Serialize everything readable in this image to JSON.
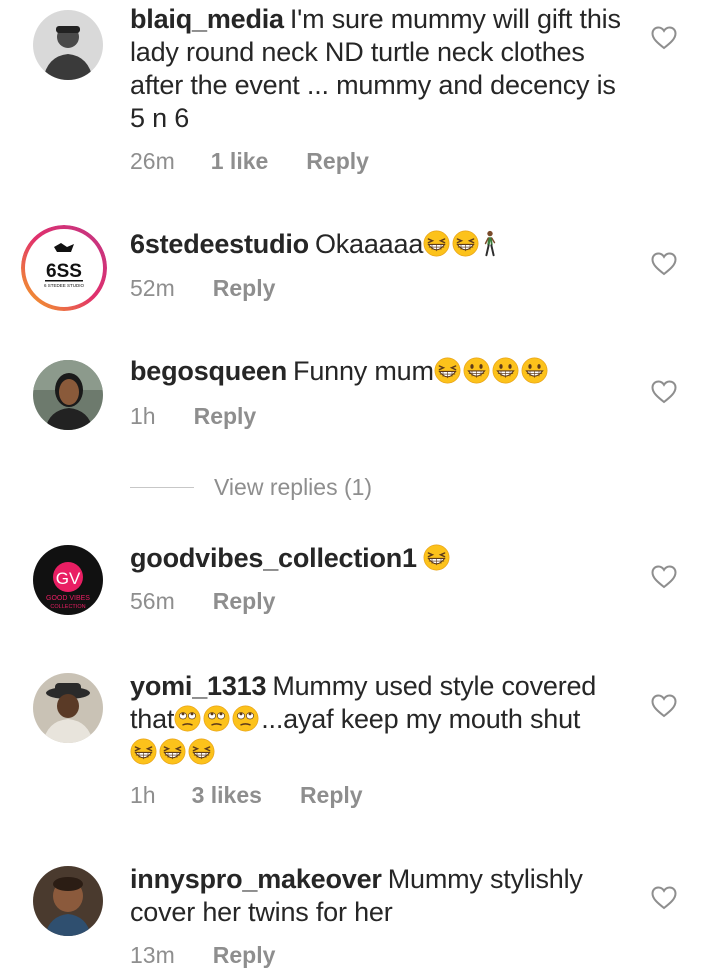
{
  "comments": [
    {
      "username": "blaiq_media",
      "text": "I'm sure mummy will gift this lady round neck ND turtle neck clothes after the event ... mummy and decency is 5 n 6",
      "time": "26m",
      "likes": "1 like",
      "reply": "Reply"
    },
    {
      "username": "6stedeestudio",
      "text": "Okaaaaa",
      "time": "52m",
      "reply": "Reply"
    },
    {
      "username": "begosqueen",
      "text": "Funny mum",
      "time": "1h",
      "reply": "Reply"
    },
    {
      "username": "goodvibes_collection1",
      "text": "",
      "time": "56m",
      "reply": "Reply"
    },
    {
      "username": "yomi_1313",
      "text_a": "Mummy used style covered that",
      "text_b": "...ayaf keep my mouth shut",
      "time": "1h",
      "likes": "3 likes",
      "reply": "Reply"
    },
    {
      "username": "innyspro_makeover",
      "text": "Mummy stylishly cover her twins for her",
      "time": "13m",
      "reply": "Reply"
    }
  ],
  "view_replies": "View replies (1)",
  "logos": {
    "studio_mark": "6SS",
    "studio_sub": "6 STEDEE STUDIO",
    "gv_mark": "GV",
    "gv_sub": "GOOD VIBES",
    "gv_sub2": "COLLECTION"
  },
  "colors": {
    "text": "#262626",
    "muted": "#8e8e8e",
    "story_ring_start": "#f5a623",
    "story_ring_end": "#c13584",
    "gv_pink": "#e91e63"
  },
  "icons": {
    "heart": "heart-outline-icon",
    "emoji_grin": "grinning-squinting-face-emoji",
    "emoji_beam": "beaming-face-emoji",
    "emoji_eyeroll": "face-with-rolling-eyes-emoji",
    "emoji_walk": "person-walking-emoji"
  }
}
